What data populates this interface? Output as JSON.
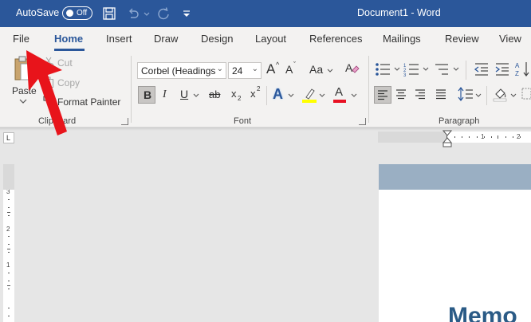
{
  "titlebar": {
    "autosave_label": "AutoSave",
    "autosave_state": "Off",
    "document_title": "Document1  -  Word"
  },
  "tabs": [
    {
      "label": "File"
    },
    {
      "label": "Home",
      "active": true
    },
    {
      "label": "Insert"
    },
    {
      "label": "Draw"
    },
    {
      "label": "Design"
    },
    {
      "label": "Layout"
    },
    {
      "label": "References"
    },
    {
      "label": "Mailings"
    },
    {
      "label": "Review"
    },
    {
      "label": "View"
    }
  ],
  "clipboard": {
    "paste_label": "Paste",
    "cut_label": "Cut",
    "copy_label": "Copy",
    "format_painter_label": "Format Painter",
    "group_label": "Clipboard"
  },
  "font": {
    "font_name": "Corbel (Headings",
    "font_size": "24",
    "grow_glyph": "A",
    "shrink_glyph": "A",
    "change_case_glyph": "Aa",
    "bold_glyph": "B",
    "italic_glyph": "I",
    "underline_glyph": "U",
    "strike_glyph": "ab",
    "subscript_glyph": "x",
    "subscript_mark": "2",
    "superscript_glyph": "x",
    "superscript_mark": "2",
    "text_effects_glyph": "A",
    "font_color_glyph": "A",
    "group_label": "Font"
  },
  "paragraph": {
    "group_label": "Paragraph"
  },
  "ruler": {
    "corner_glyph": "L",
    "h_ticks": [
      "1",
      "1",
      "2"
    ],
    "v_ticks": [
      "3",
      "2",
      "1"
    ]
  },
  "document": {
    "heading_text": "Memo"
  },
  "colors": {
    "brand_blue": "#2b579a",
    "highlight_yellow": "#ffff00",
    "font_color_red": "#e81123",
    "arrow_red": "#e8141b"
  }
}
